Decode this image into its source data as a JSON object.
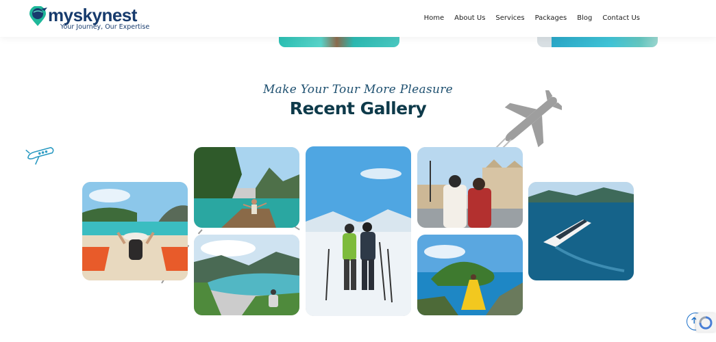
{
  "brand": {
    "name": "myskynest",
    "tagline": "Your Journey, Our Expertise",
    "color": "#173b6d",
    "accent": "#1fb89a"
  },
  "nav": {
    "items": [
      "Home",
      "About Us",
      "Services",
      "Packages",
      "Blog",
      "Contact Us"
    ]
  },
  "gallery": {
    "subtitle": "Make Your Tour More Pleasure",
    "title": "Recent Gallery",
    "photos": [
      {
        "name": "beach-lounge-photo"
      },
      {
        "name": "boat-lagoon-photo"
      },
      {
        "name": "fjord-hiker-photo"
      },
      {
        "name": "ski-couple-photo"
      },
      {
        "name": "city-selfie-photo"
      },
      {
        "name": "island-view-photo"
      },
      {
        "name": "cruise-ship-photo"
      }
    ]
  },
  "icons": {
    "scroll_top": "arrow-up-icon",
    "decor_plane": "airplane-icon"
  },
  "colors": {
    "heading": "#0e3a4a",
    "subheading": "#1d4f6f",
    "scroll_button": "#1a6fc9"
  }
}
